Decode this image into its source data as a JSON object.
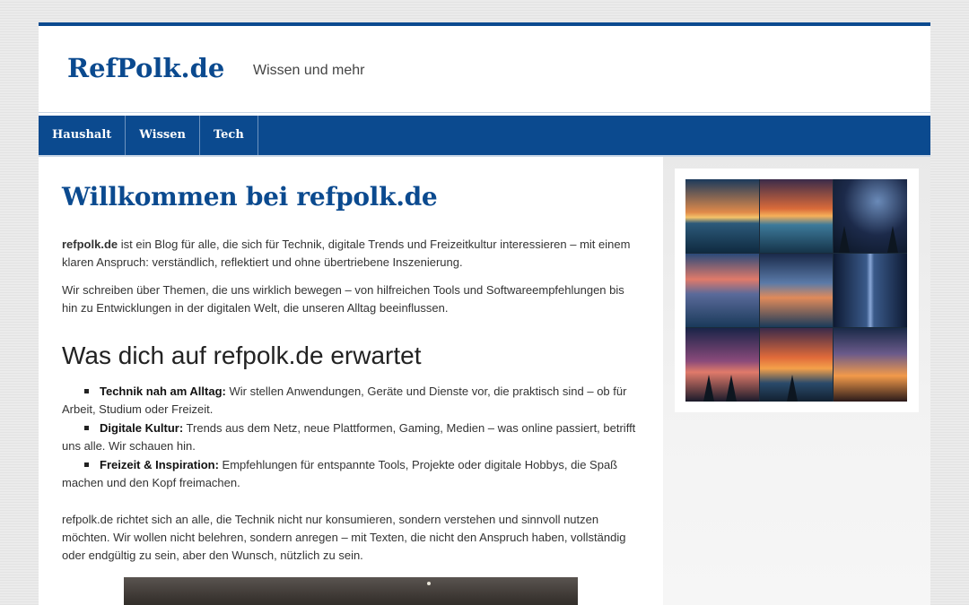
{
  "header": {
    "site_title": "RefPolk.de",
    "site_description": "Wissen und mehr"
  },
  "nav": {
    "items": [
      {
        "label": "Haushalt"
      },
      {
        "label": "Wissen"
      },
      {
        "label": "Tech"
      }
    ]
  },
  "main": {
    "title": "Willkommen bei refpolk.de",
    "intro_brand": "refpolk.de",
    "intro_rest": " ist ein Blog für alle, die sich für Technik, digitale Trends und Freizeitkultur interessieren – mit einem klaren Anspruch: verständlich, reflektiert und ohne übertriebene Inszenierung.",
    "paragraph2": "Wir schreiben über Themen, die uns wirklich bewegen – von hilfreichen Tools und Softwareempfehlungen bis hin zu Entwicklungen in der digitalen Welt, die unseren Alltag beeinflussen.",
    "section_title": "Was dich auf refpolk.de erwartet",
    "features": [
      {
        "title": "Technik nah am Alltag:",
        "text": " Wir stellen Anwendungen, Geräte und Dienste vor, die praktisch sind – ob für Arbeit, Studium oder Freizeit."
      },
      {
        "title": "Digitale Kultur:",
        "text": " Trends aus dem Netz, neue Plattformen, Gaming, Medien – was online passiert, betrifft uns alle. Wir schauen hin."
      },
      {
        "title": "Freizeit & Inspiration:",
        "text": " Empfehlungen für entspannte Tools, Projekte oder digitale Hobbys, die Spaß machen und den Kopf freimachen."
      }
    ],
    "paragraph3": "refpolk.de richtet sich an alle, die Technik nicht nur konsumieren, sondern verstehen und sinnvoll nutzen möchten. Wir wollen nicht belehren, sondern anregen – mit Texten, die nicht den Anspruch haben, vollständig oder endgültig zu sein, aber den Wunsch, nützlich zu sein."
  },
  "colors": {
    "brand": "#0b4a8f",
    "background": "#e6e6e6"
  }
}
